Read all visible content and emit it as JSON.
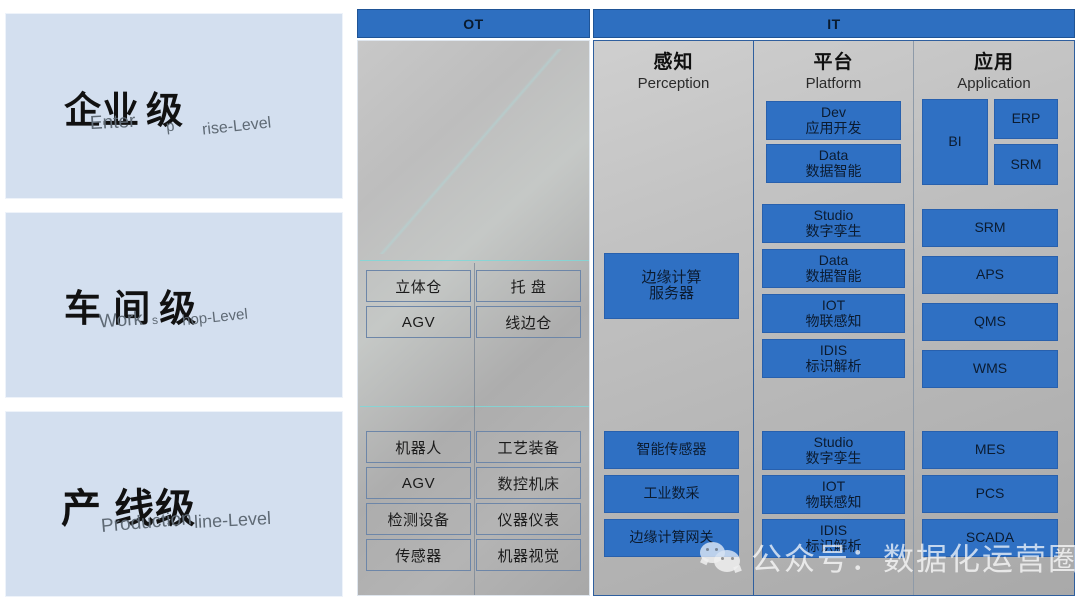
{
  "levels": [
    {
      "cn": "企业",
      "cn_suffix": "级",
      "en_part1": "Enter",
      "en_part2": "p",
      "en_part3": "rise-Level",
      "name": "enterprise-level"
    },
    {
      "cn": "车 间",
      "cn_suffix": "级",
      "en_part1": "Work",
      "en_part2": "s",
      "en_part3": "hop-Level",
      "name": "workshop-level"
    },
    {
      "cn": "产 线级",
      "cn_suffix": "",
      "en_part1": "Production",
      "en_part2": "line-Level",
      "en_part3": "",
      "name": "production-line-level"
    }
  ],
  "bands": {
    "ot_label": "OT",
    "it_label": "IT"
  },
  "ot": {
    "middle_cells": [
      "立体仓",
      "托 盘",
      "AGV",
      "线边仓"
    ],
    "bottom_cells": [
      "机器人",
      "工艺装备",
      "AGV",
      "数控机床",
      "检测设备",
      "仪器仪表",
      "传感器",
      "机器视觉"
    ]
  },
  "it": {
    "columns": [
      {
        "cn": "感知",
        "en": "Perception",
        "boxes": [
          {
            "name": "edge-computing-server",
            "l1": "边缘计算",
            "l2": "服务器"
          },
          {
            "name": "smart-sensor",
            "l1": "智能传感器",
            "l2": ""
          },
          {
            "name": "industrial-data-acquisition",
            "l1": "工业数采",
            "l2": ""
          },
          {
            "name": "edge-computing-gateway",
            "l1": "边缘计算网关",
            "l2": ""
          }
        ]
      },
      {
        "cn": "平台",
        "en": "Platform",
        "boxes": [
          {
            "name": "dev",
            "l1": "Dev",
            "l2": "应用开发"
          },
          {
            "name": "data-1",
            "l1": "Data",
            "l2": "数据智能"
          },
          {
            "name": "studio-1",
            "l1": "Studio",
            "l2": "数字孪生"
          },
          {
            "name": "data-2",
            "l1": "Data",
            "l2": "数据智能"
          },
          {
            "name": "iot-1",
            "l1": "IOT",
            "l2": "物联感知"
          },
          {
            "name": "idis-1",
            "l1": "IDIS",
            "l2": "标识解析"
          },
          {
            "name": "studio-2",
            "l1": "Studio",
            "l2": "数字孪生"
          },
          {
            "name": "iot-2",
            "l1": "IOT",
            "l2": "物联感知"
          },
          {
            "name": "idis-2",
            "l1": "IDIS",
            "l2": "标识解析"
          }
        ]
      },
      {
        "cn": "应用",
        "en": "Application",
        "boxes": [
          {
            "name": "bi",
            "l1": "BI",
            "l2": ""
          },
          {
            "name": "erp",
            "l1": "ERP",
            "l2": ""
          },
          {
            "name": "srm-small",
            "l1": "SRM",
            "l2": ""
          },
          {
            "name": "srm",
            "l1": "SRM",
            "l2": ""
          },
          {
            "name": "aps",
            "l1": "APS",
            "l2": ""
          },
          {
            "name": "qms",
            "l1": "QMS",
            "l2": ""
          },
          {
            "name": "wms",
            "l1": "WMS",
            "l2": ""
          },
          {
            "name": "mes",
            "l1": "MES",
            "l2": ""
          },
          {
            "name": "pcs",
            "l1": "PCS",
            "l2": ""
          },
          {
            "name": "scada",
            "l1": "SCADA",
            "l2": ""
          }
        ]
      }
    ]
  },
  "watermark": {
    "text": "公众号：数据化运营圈",
    "icon": "wechat-icon"
  },
  "colors": {
    "band_blue": "#2e6fc0",
    "box_blue": "#2f70c3",
    "level_panel": "#d3dfef",
    "ot_gray": "#bdbdbd",
    "divider_cyan": "#7fd8d8"
  }
}
